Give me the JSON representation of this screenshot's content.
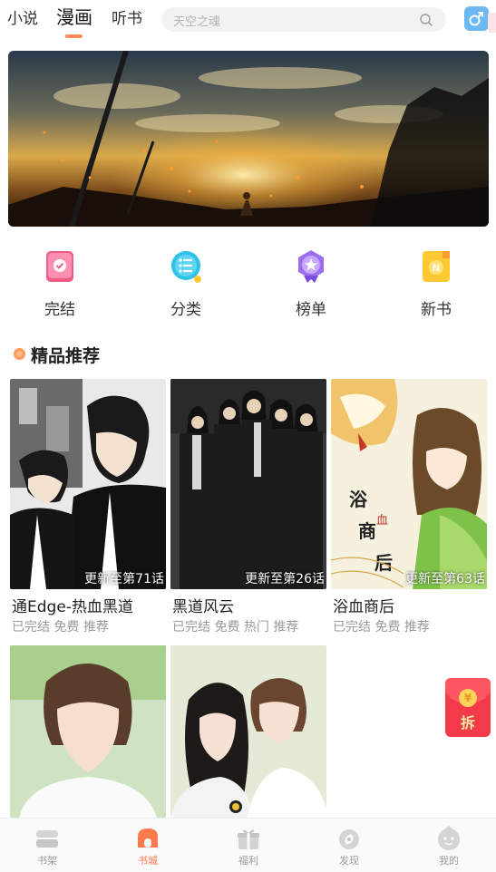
{
  "top_tabs": [
    {
      "label": "小说"
    },
    {
      "label": "漫画"
    },
    {
      "label": "听书"
    }
  ],
  "search": {
    "placeholder": "天空之魂",
    "icon": "search-icon"
  },
  "gender_icon": "male-icon",
  "quick_entries": [
    {
      "label": "完结",
      "icon": "finished-book-icon",
      "color": "#f25c84"
    },
    {
      "label": "分类",
      "icon": "category-list-icon",
      "color": "#2fc1e8"
    },
    {
      "label": "榜单",
      "icon": "ranking-medal-icon",
      "color": "#9b6df0"
    },
    {
      "label": "新书",
      "icon": "new-book-icon",
      "color": "#ffc933"
    }
  ],
  "section": {
    "title": "精品推荐"
  },
  "comics": [
    {
      "title": "通Edge-热血黑道",
      "update": "更新至第71话",
      "tags": "已完结 免费 推荐"
    },
    {
      "title": "黑道风云",
      "update": "更新至第26话",
      "tags": "已完结 免费 热门 推荐"
    },
    {
      "title": "浴血商后",
      "update": "更新至第63话",
      "tags": "已完结 免费 推荐",
      "cover_text": "浴血商后"
    },
    {
      "title": "",
      "update": "",
      "tags": ""
    },
    {
      "title": "",
      "update": "",
      "tags": ""
    }
  ],
  "red_packet": {
    "label": "拆",
    "coin": "¥"
  },
  "bottom_nav": [
    {
      "label": "书架",
      "icon": "bookshelf-icon"
    },
    {
      "label": "书城",
      "icon": "bookstore-icon"
    },
    {
      "label": "福利",
      "icon": "gift-icon"
    },
    {
      "label": "发现",
      "icon": "discover-icon"
    },
    {
      "label": "我的",
      "icon": "profile-icon"
    }
  ],
  "colors": {
    "accent": "#ff7a4a",
    "packet": "#f23a4a"
  }
}
